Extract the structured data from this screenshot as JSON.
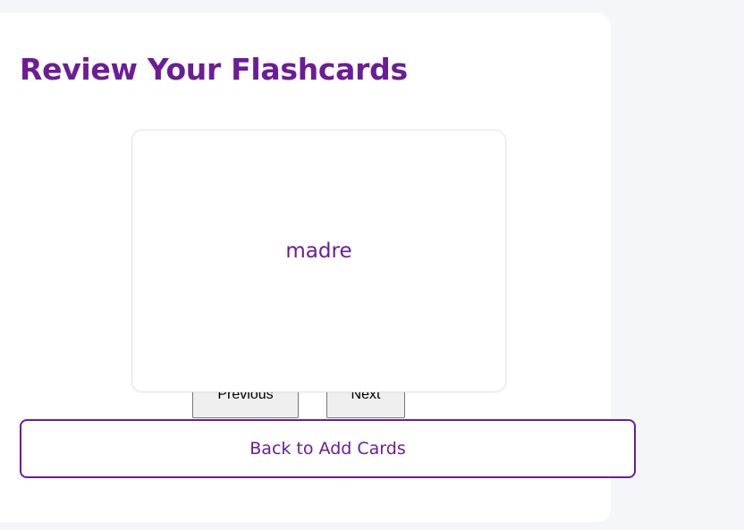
{
  "page": {
    "title": "Review Your Flashcards"
  },
  "flashcard": {
    "text": "madre"
  },
  "navigation": {
    "previous_label": "Previous",
    "next_label": "Next"
  },
  "actions": {
    "back_label": "Back to Add Cards"
  },
  "colors": {
    "accent": "#6b1d98",
    "background": "#f5f6fa",
    "panel": "#ffffff",
    "button_gray": "#efefef"
  }
}
